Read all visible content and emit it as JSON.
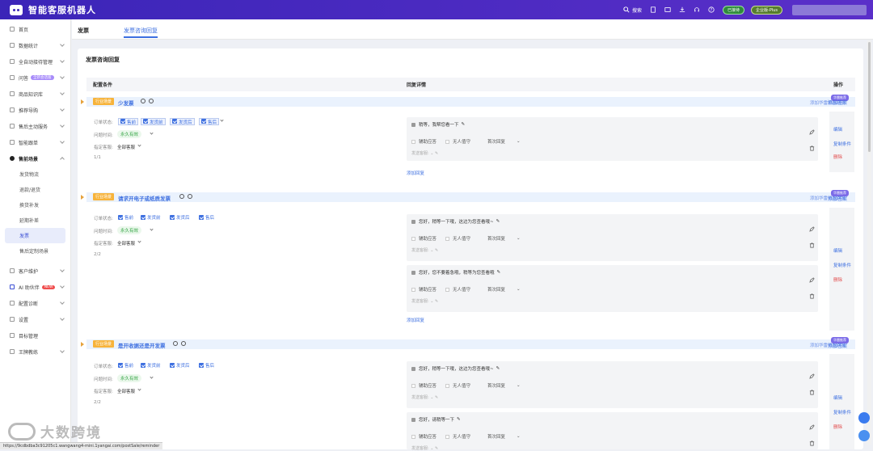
{
  "app": {
    "title": "智能客服机器人"
  },
  "topbar": {
    "search": "搜索",
    "badge1": "已接待",
    "badge2": "企业版-Plus"
  },
  "sidebar": {
    "items": [
      {
        "label": "首页"
      },
      {
        "label": "数据统计"
      },
      {
        "label": "全自动接待管理"
      },
      {
        "label": "问答",
        "tag": "全新会话版"
      },
      {
        "label": "商品知识库"
      },
      {
        "label": "推荐导购"
      },
      {
        "label": "售后主动服务"
      },
      {
        "label": "智能跟单"
      },
      {
        "label": "售前场景"
      }
    ],
    "sub_items": [
      {
        "label": "发货物流"
      },
      {
        "label": "退款/退货"
      },
      {
        "label": "换货补发"
      },
      {
        "label": "延期补差"
      },
      {
        "label": "发票"
      },
      {
        "label": "售后定制场景"
      }
    ],
    "bottom_items": [
      {
        "label": "客户维护"
      },
      {
        "label": "AI 助伙伴",
        "tag": "NEW"
      },
      {
        "label": "配置诊断"
      },
      {
        "label": "设置"
      },
      {
        "label": "目标管理"
      },
      {
        "label": "王牌教练"
      }
    ]
  },
  "tabs": {
    "tab1": "发票",
    "tab2": "发票咨询回复"
  },
  "panel": {
    "title": "发票咨询回复",
    "col_config": "配置条件",
    "col_reply": "回复详情",
    "col_action": "操作"
  },
  "common": {
    "industry_tag": "行业场景",
    "add_robot_reply": "添加华雷机器回复",
    "robot_tag": "华雷推荐",
    "add_answer": "添加答案",
    "order_status_label": "订单状态:",
    "question_time_label": "问题时间:",
    "designate_label": "指定客服:",
    "status_options": [
      "售前",
      "发货前",
      "发货后",
      "售后"
    ],
    "time_value": "永久有效",
    "designate_value": "全部客服",
    "assist_reply": "辅助应答",
    "unmanned": "无人值守",
    "first_reply": "首次回复",
    "send_config": "发送客服:",
    "add_reply": "添加回复",
    "edit": "编辑",
    "copy_condition": "复制条件",
    "delete": "删除"
  },
  "groups": [
    {
      "name": "少发票",
      "counter": "1/1",
      "replies": [
        "稍等，我帮您看一下"
      ]
    },
    {
      "name": "请求开电子或纸质发票",
      "counter": "2/2",
      "replies": [
        "您好，稍等一下哦，这边为您查看哦~",
        "您好，您不要着急哦，稍等为您查看哦"
      ]
    },
    {
      "name": "是开收据还是开发票",
      "counter": "2/2",
      "replies": [
        "您好，稍等一下哦，这边为您查看哦~",
        "您好，请稍等一下"
      ]
    }
  ],
  "statusbar": {
    "url": "https://9cdbdba3c91205c1.wangwang4-mini.1yangai.com/postSale/reminder"
  },
  "watermark": {
    "text": "大数跨境"
  },
  "colors": {
    "topbar": "#4a2bc4",
    "accent": "#3d6fe0",
    "orange_tag": "#f7b33a",
    "danger": "#e24b4b"
  }
}
